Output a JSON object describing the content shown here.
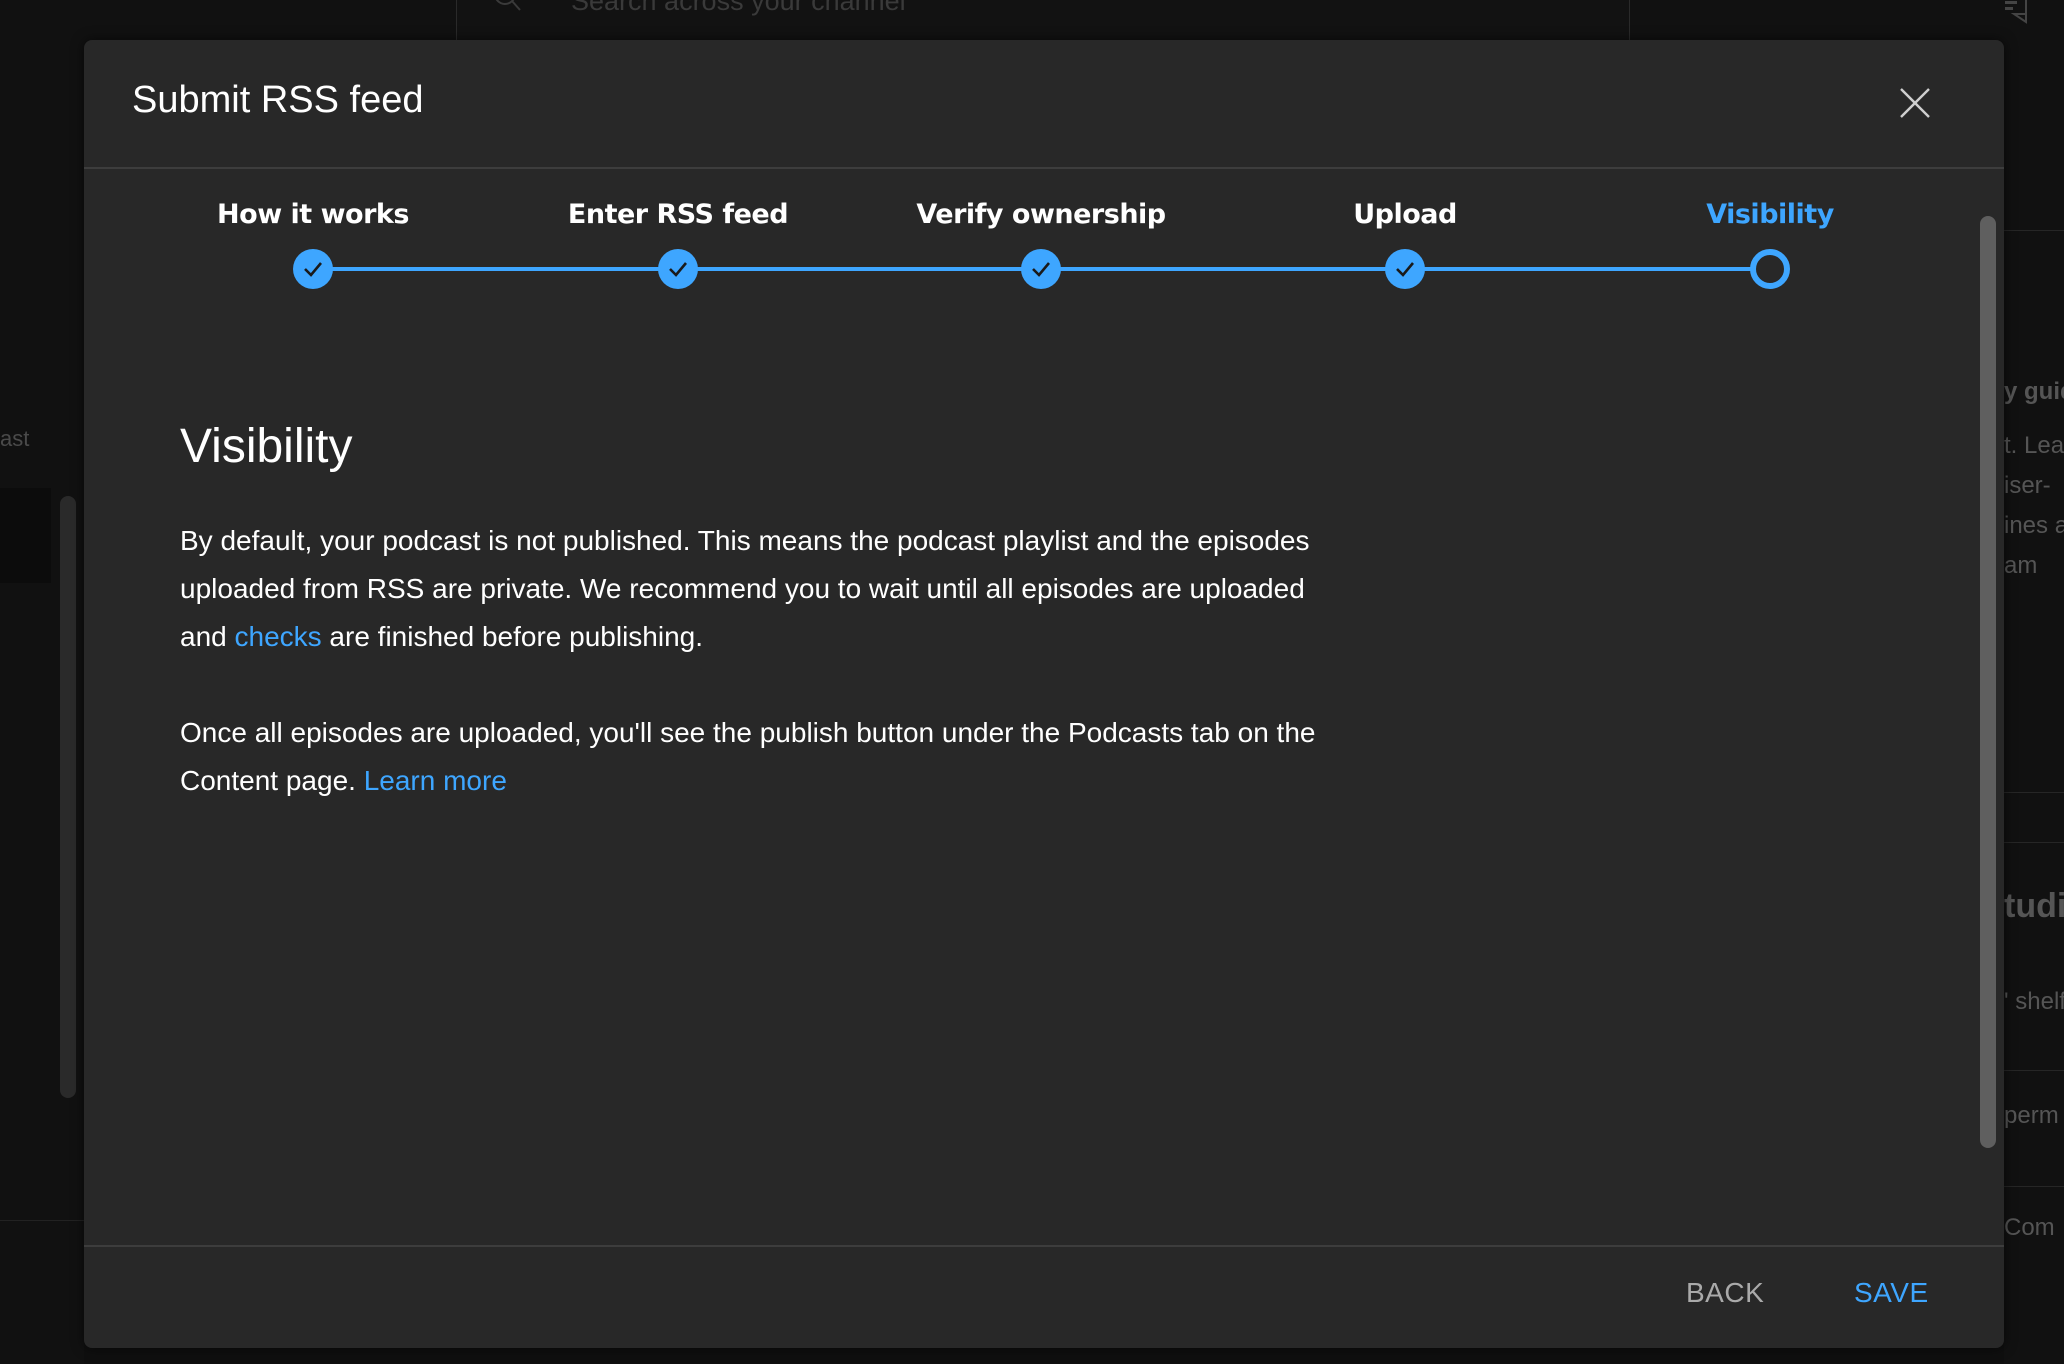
{
  "background": {
    "search_placeholder": "Search across your channel",
    "left_text": "ast",
    "right_texts": [
      "y guid",
      "t. Lea",
      "iser-",
      "ines a",
      "am",
      "tudio",
      "' shelf",
      "perm",
      "Com"
    ]
  },
  "dialog": {
    "title": "Submit RSS feed",
    "close_label": "×",
    "steps": [
      {
        "label": "How it works",
        "state": "completed"
      },
      {
        "label": "Enter RSS feed",
        "state": "completed"
      },
      {
        "label": "Verify ownership",
        "state": "completed"
      },
      {
        "label": "Upload",
        "state": "completed"
      },
      {
        "label": "Visibility",
        "state": "current"
      }
    ],
    "heading": "Visibility",
    "paragraph1": {
      "before": "By default, your podcast is not published. This means the podcast playlist and the episodes uploaded from RSS are private. We recommend you to wait until all episodes are uploaded and ",
      "link": "checks",
      "after": " are finished before publishing."
    },
    "paragraph2": {
      "before": "Once all episodes are uploaded, you'll see the publish button under the Podcasts tab on the Content page. ",
      "link": "Learn more"
    },
    "footer": {
      "back_label": "BACK",
      "save_label": "SAVE"
    }
  },
  "colors": {
    "accent": "#3ea6ff",
    "dialog_bg": "#282828",
    "page_bg": "#0f0f0f",
    "secondary_text": "#aaaaaa"
  }
}
